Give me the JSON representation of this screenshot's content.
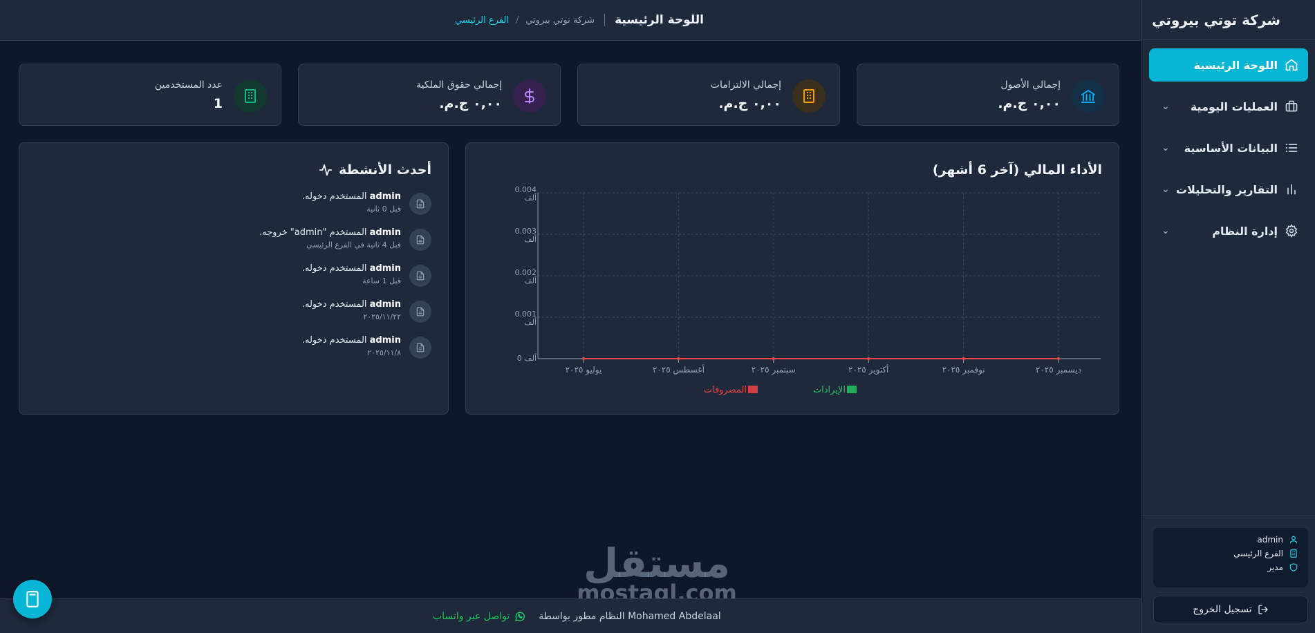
{
  "sidebar": {
    "brand": "شركة توتي بيروتي",
    "items": [
      {
        "label": "اللوحة الرئيسية"
      },
      {
        "label": "العمليات اليومية"
      },
      {
        "label": "البيانات الأساسية"
      },
      {
        "label": "التقارير والتحليلات"
      },
      {
        "label": "إدارة النظام"
      }
    ],
    "user": {
      "name": "admin",
      "branch": "الفرع الرئيسي",
      "role": "مدير"
    },
    "logout_label": "تسجيل الخروج"
  },
  "header": {
    "title": "اللوحة الرئيسية",
    "company": "شركة توتي بيروتي",
    "separator": "/",
    "branch": "الفرع الرئيسي"
  },
  "stats": [
    {
      "label": "إجمالي الأصول",
      "value": "٠,٠٠ ج.م.",
      "icon": "bank-icon",
      "color": "#0ea5e9"
    },
    {
      "label": "إجمالي الالتزامات",
      "value": "٠,٠٠ ج.م.",
      "icon": "building-icon",
      "color": "#f59e0b"
    },
    {
      "label": "إجمالي حقوق الملكية",
      "value": "٠,٠٠ ج.م.",
      "icon": "dollar-icon",
      "color": "#a855f7"
    },
    {
      "label": "عدد المستخدمين",
      "value": "1",
      "icon": "users-building-icon",
      "color": "#10b981"
    }
  ],
  "chart": {
    "title": "الأداء المالي (آخر 6 أشهر)"
  },
  "chart_data": {
    "type": "line",
    "categories": [
      "يوليو ٢٠٢٥",
      "أغسطس ٢٠٢٥",
      "سبتمبر ٢٠٢٥",
      "أكتوبر ٢٠٢٥",
      "نوفمبر ٢٠٢٥",
      "ديسمبر ٢٠٢٥"
    ],
    "series": [
      {
        "name": "الإيرادات",
        "values": [
          0,
          0,
          0,
          0,
          0,
          0
        ],
        "color": "#22c55e"
      },
      {
        "name": "المصروفات",
        "values": [
          0,
          0,
          0,
          0,
          0,
          0
        ],
        "color": "#ef4444"
      }
    ],
    "y_ticks": [
      {
        "value": 0,
        "label": "0 ألف"
      },
      {
        "value": 0.001,
        "label": "0.001 ألف"
      },
      {
        "value": 0.002,
        "label": "0.002 ألف"
      },
      {
        "value": 0.003,
        "label": "0.003 ألف"
      },
      {
        "value": 0.004,
        "label": "0.004 ألف"
      }
    ],
    "ylim": [
      0,
      0.004
    ],
    "grid": true,
    "legend": "bottom"
  },
  "activity": {
    "title": "أحدث الأنشطة",
    "items": [
      {
        "user": "admin",
        "text": " المستخدم دخوله.",
        "sub": "قبل 0 ثانية"
      },
      {
        "user": "admin",
        "text": " المستخدم \"admin\" خروجه.",
        "sub": "قبل 4 ثانية في الفرع الرئيسي"
      },
      {
        "user": "admin",
        "text": " المستخدم دخوله.",
        "sub": "قبل 1 ساعة"
      },
      {
        "user": "admin",
        "text": " المستخدم دخوله.",
        "sub": "٢٠٢٥/١١/٢٢"
      },
      {
        "user": "admin",
        "text": " المستخدم دخوله.",
        "sub": "٢٠٢٥/١١/٨"
      }
    ]
  },
  "footer": {
    "credit": "النظام مطور بواسطة Mohamed Abdelaal",
    "whatsapp": "تواصل عبر واتساب"
  },
  "watermark": {
    "ar": "مستقل",
    "en": "mostaql.com"
  }
}
